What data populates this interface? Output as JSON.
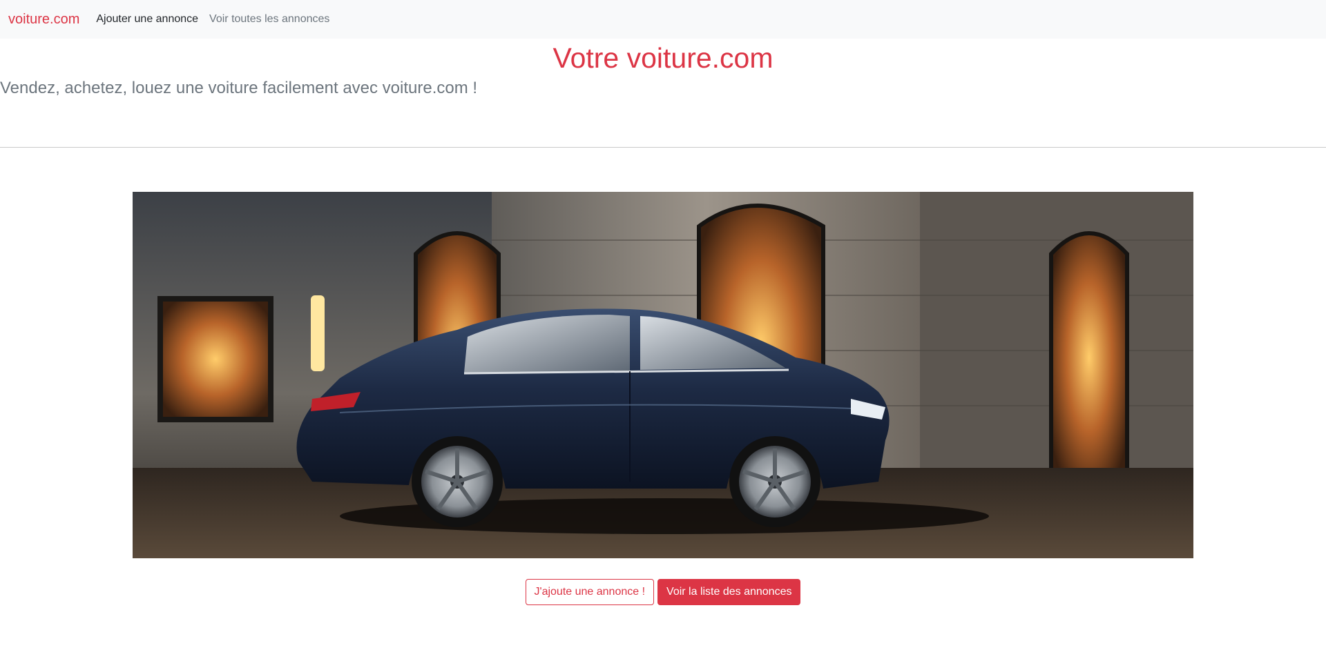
{
  "navbar": {
    "brand": "voiture.com",
    "links": [
      {
        "label": "Ajouter une annonce",
        "active": true
      },
      {
        "label": "Voir toutes les annonces",
        "active": false
      }
    ]
  },
  "hero": {
    "title": "Votre voiture.com",
    "lead": "Vendez, achetez, louez une voiture facilement avec voiture.com !"
  },
  "image": {
    "subject": "dark blue sedan parked in front of a stone building at night"
  },
  "actions": {
    "add_label": "J'ajoute une annonce !",
    "list_label": "Voir la liste des annonces"
  },
  "colors": {
    "accent": "#dc3545",
    "navbar_bg": "#f8f9fa",
    "muted_text": "#6c757d"
  }
}
